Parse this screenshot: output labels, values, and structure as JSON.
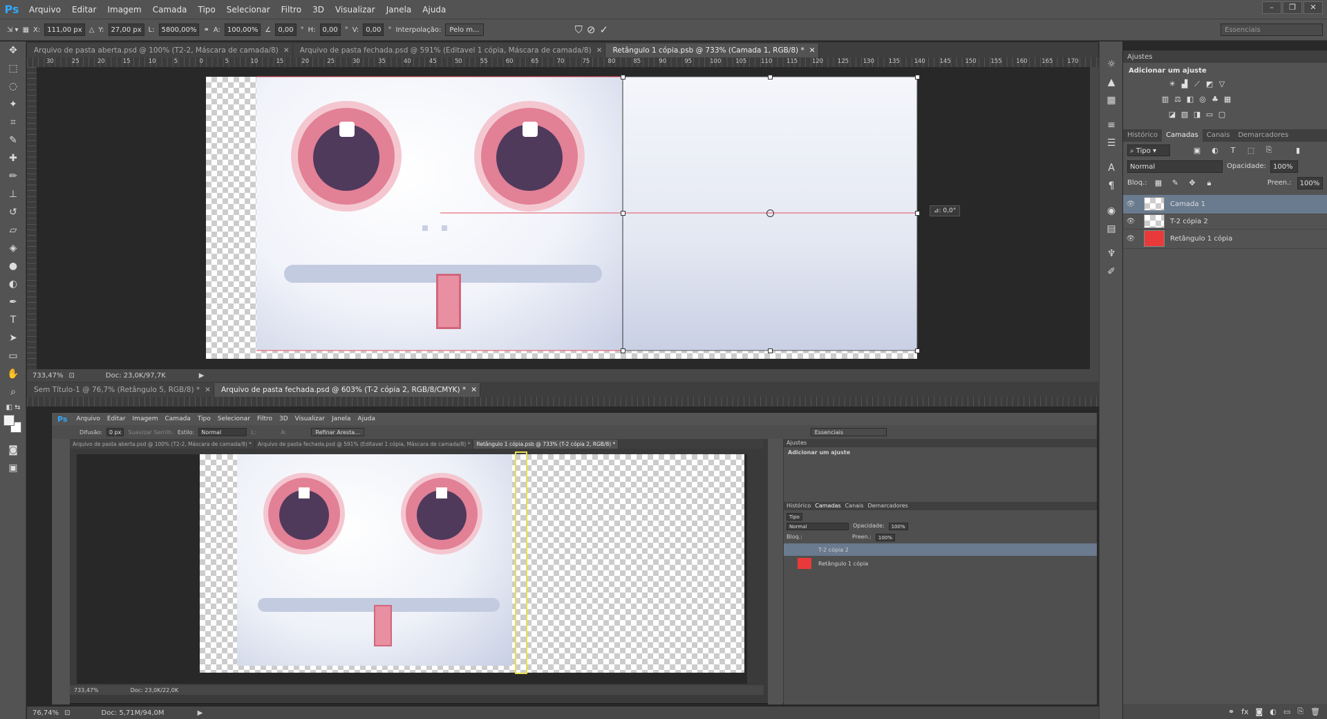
{
  "app": {
    "logo": "Ps"
  },
  "menu": [
    "Arquivo",
    "Editar",
    "Imagem",
    "Camada",
    "Tipo",
    "Selecionar",
    "Filtro",
    "3D",
    "Visualizar",
    "Janela",
    "Ajuda"
  ],
  "window_buttons": [
    "–",
    "❐",
    "✕"
  ],
  "options": {
    "x_label": "X:",
    "x_value": "111,00 px",
    "y_label": "Y:",
    "y_value": "27,00 px",
    "w_label": "L:",
    "w_value": "5800,00%",
    "h_label": "A:",
    "h_value": "100,00%",
    "angle_value": "0,00",
    "angle_unit": "°",
    "hskew_label": "H:",
    "hskew_value": "0,00",
    "hskew_unit": "°",
    "vskew_label": "V:",
    "vskew_value": "0,00",
    "vskew_unit": "°",
    "interp_label": "Interpolação:",
    "interp_value": "Pelo m...",
    "workspace": "Essenciais"
  },
  "top_doc": {
    "tabs": [
      "Arquivo de pasta aberta.psd @ 100% (T2-2, Máscara de camada/8)",
      "Arquivo de pasta fechada.psd @ 591% (Editavel 1 cópia, Máscara de camada/8)",
      "Retângulo 1 cópia.psb @ 733% (Camada 1, RGB/8) *"
    ],
    "active_tab": 2,
    "ruler_ticks": [
      "30",
      "25",
      "20",
      "15",
      "10",
      "5",
      "0",
      "5",
      "10",
      "15",
      "20",
      "25",
      "30",
      "35",
      "40",
      "45",
      "50",
      "55",
      "60",
      "65",
      "70",
      "75",
      "80",
      "85",
      "90",
      "95",
      "100",
      "105",
      "110",
      "115",
      "120",
      "125",
      "130",
      "135",
      "140",
      "145",
      "150",
      "155",
      "160",
      "165",
      "170"
    ],
    "angle_tooltip": "⊿: 0,0°",
    "zoom": "733,47%",
    "doc": "Doc: 23,0K/97,7K"
  },
  "bottom_doc": {
    "tabs": [
      "Sem Título-1 @ 76,7% (Retângulo 5, RGB/8) *",
      "Arquivo de pasta fechada.psd @ 603% (T-2 cópia 2, RGB/8/CMYK) *"
    ],
    "zoom": "76,74%",
    "doc": "Doc: 5,71M/94,0M",
    "inner": {
      "menu": [
        "Arquivo",
        "Editar",
        "Imagem",
        "Camada",
        "Tipo",
        "Selecionar",
        "Filtro",
        "3D",
        "Visualizar",
        "Janela",
        "Ajuda"
      ],
      "opt_difusao": "Difusão:",
      "opt_difusao_val": "0 px",
      "opt_suavizar": "Suavizar Serrilh.",
      "opt_estilo": "Estilo:",
      "opt_estilo_val": "Normal",
      "opt_l": "L:",
      "opt_a": "A:",
      "opt_refinar": "Refinar Arestа...",
      "workspace": "Essenciais",
      "tabs": [
        "Arquivo de pasta aberta.psd @ 100% (T2-2, Máscara de camada/8) *",
        "Arquivo de pasta fechada.psd @ 591% (Editavel 1 cópia, Máscara de camada/8) *",
        "Retângulo 1 cópia.psb @ 733% (T-2 cópia 2, RGB/8) *"
      ],
      "zoom": "733,47%",
      "doc": "Doc: 23,0K/22,0K",
      "panel_title": "Ajustes",
      "panel_sub": "Adicionar um ajuste",
      "ptabs": [
        "Histórico",
        "Camadas",
        "Canais",
        "Demarcadores"
      ],
      "kind": "Tipo",
      "blend": "Normal",
      "opacity_label": "Opacidade:",
      "opacity": "100%",
      "lock_label": "Bloq.:",
      "fill_label": "Preen.:",
      "fill": "100%",
      "layers": [
        "T-2 cópia 2",
        "Retângulo 1 cópia"
      ]
    }
  },
  "panels": {
    "adjust_title": "Ajustes",
    "adjust_sub": "Adicionar um ajuste",
    "tabs": [
      "Histórico",
      "Camadas",
      "Canais",
      "Demarcadores"
    ],
    "active_tab": 1,
    "kind": "Tipo",
    "blend": "Normal",
    "opacity_label": "Opacidade:",
    "opacity": "100%",
    "lock_label": "Bloq.:",
    "fill_label": "Preen.:",
    "fill": "100%",
    "layers": [
      {
        "name": "Camada 1",
        "selected": true
      },
      {
        "name": "T-2 cópia 2",
        "selected": false
      },
      {
        "name": "Retângulo 1 cópia",
        "selected": false
      }
    ]
  },
  "colors": {
    "accent": "#31a8ff",
    "layer_red": "#e83a3a",
    "selection": "#6a7a8f"
  }
}
